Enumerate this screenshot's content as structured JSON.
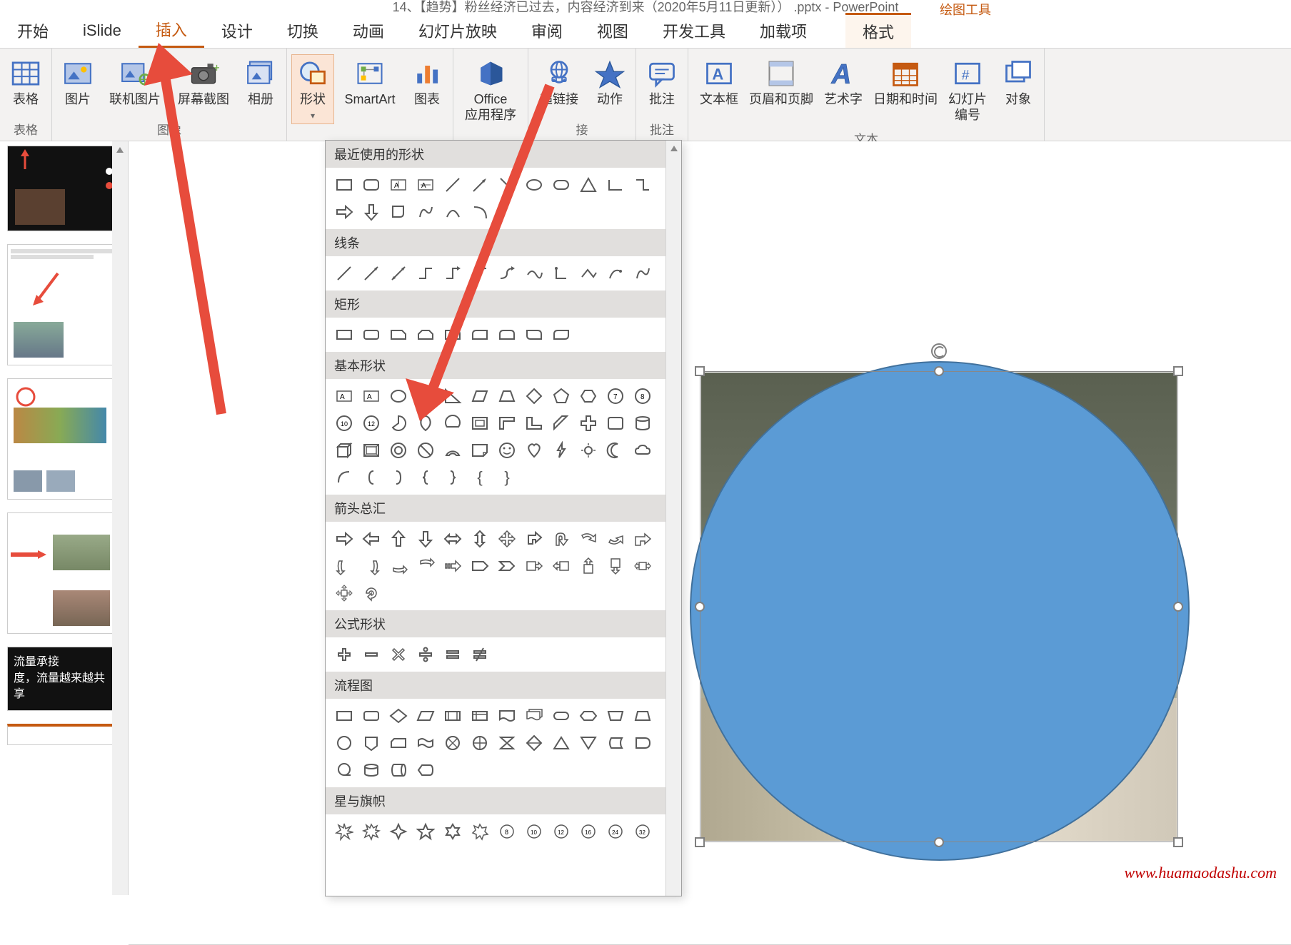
{
  "title": "14、【趋势】粉丝经济已过去，内容经济到来（2020年5月11日更新）） .pptx - PowerPoint",
  "contextual_tool": "绘图工具",
  "tabs": {
    "start": "开始",
    "islide": "iSlide",
    "insert": "插入",
    "design": "设计",
    "transition": "切换",
    "animation": "动画",
    "slideshow": "幻灯片放映",
    "review": "审阅",
    "view": "视图",
    "developer": "开发工具",
    "addins": "加载项",
    "format": "格式"
  },
  "ribbon": {
    "table": "表格",
    "picture": "图片",
    "online_picture": "联机图片",
    "screenshot": "屏幕截图",
    "album": "相册",
    "shapes": "形状",
    "smartart": "SmartArt",
    "chart": "图表",
    "office_apps": "Office\n应用程序",
    "hyperlink": "超链接",
    "action": "动作",
    "comment": "批注",
    "textbox": "文本框",
    "header_footer": "页眉和页脚",
    "wordart": "艺术字",
    "date_time": "日期和时间",
    "slide_number": "幻灯片\n编号",
    "object": "对象",
    "group_tables": "表格",
    "group_images": "图像",
    "group_links": "接",
    "group_comments": "批注",
    "group_text": "文本"
  },
  "shapes_dropdown": {
    "recent": "最近使用的形状",
    "lines": "线条",
    "rectangles": "矩形",
    "basic": "基本形状",
    "arrows": "箭头总汇",
    "equation": "公式形状",
    "flowchart": "流程图",
    "stars": "星与旗帜"
  },
  "thumb5_text1": "流量承接",
  "thumb5_text2": "度，流量越来越共享",
  "watermark": "www.huamaodashu.com"
}
